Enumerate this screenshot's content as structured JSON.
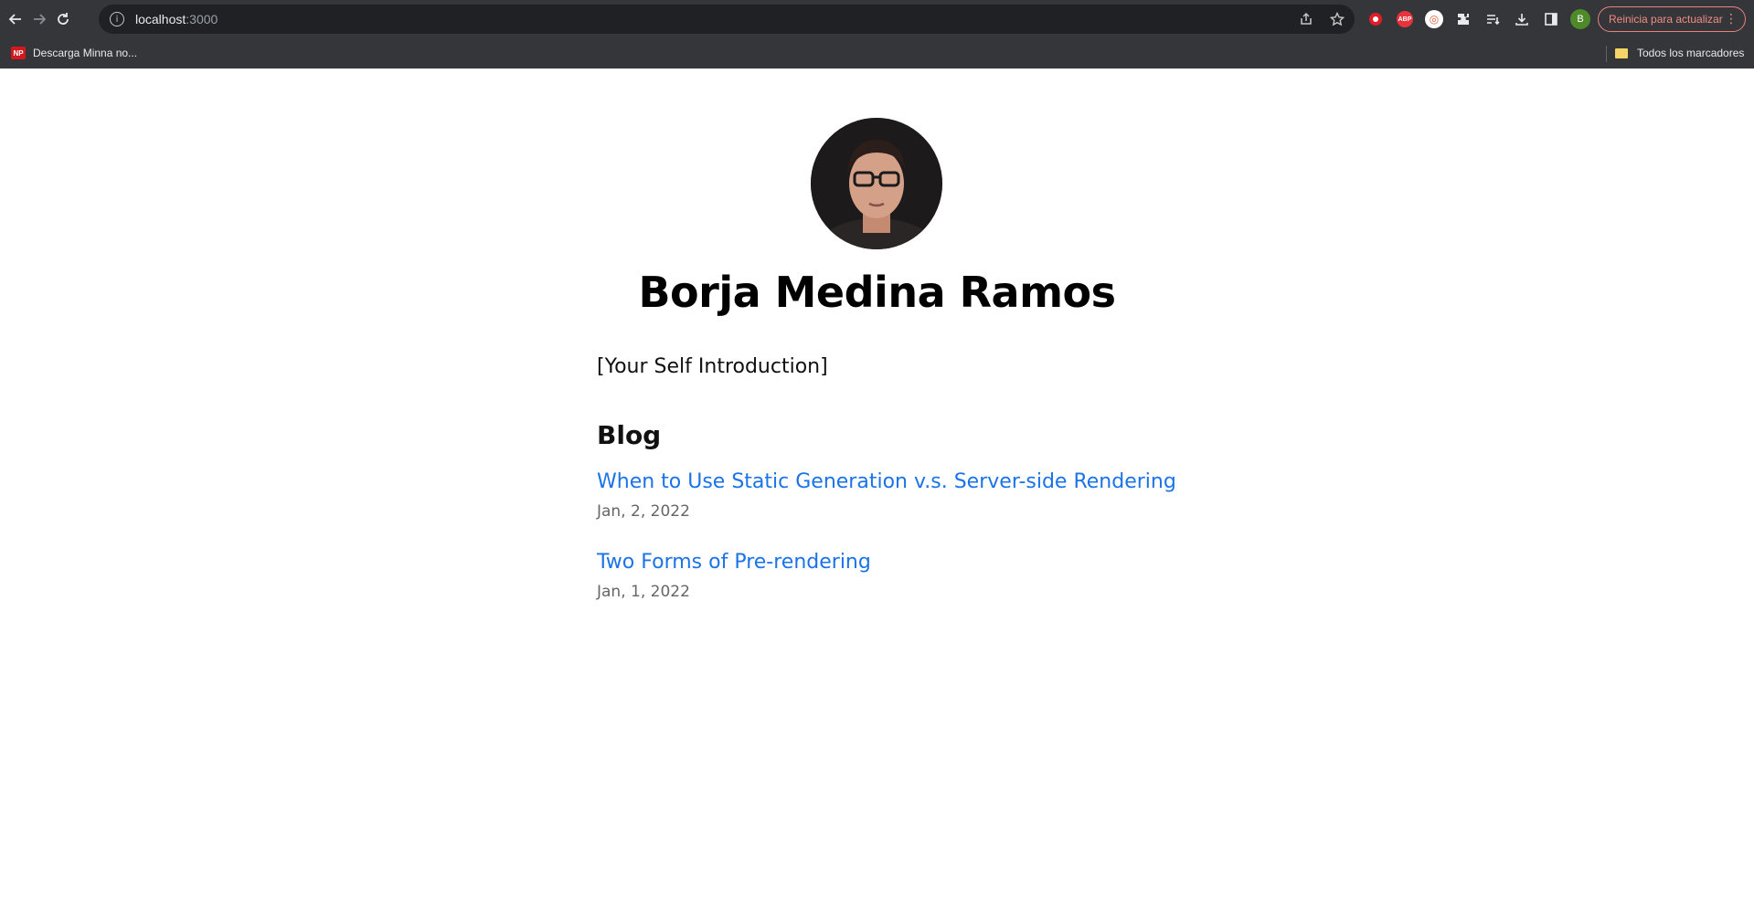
{
  "browser": {
    "url_host": "localhost",
    "url_port": ":3000",
    "update_button_label": "Reinicia para actualizar",
    "profile_initial": "B",
    "icons": {
      "back": "arrow-left-icon",
      "forward": "arrow-right-icon",
      "reload": "reload-icon",
      "site_info": "info-icon",
      "share": "share-icon",
      "bookmark": "star-icon",
      "extensions": "puzzle-icon",
      "reading_list": "reading-list-icon",
      "downloads": "download-icon",
      "side_panel": "side-panel-icon",
      "menu": "more-vertical-icon"
    }
  },
  "bookmarks_bar": {
    "items": [
      {
        "badge": "NP",
        "label": "Descarga Minna no..."
      }
    ],
    "all_bookmarks_label": "Todos los marcadores"
  },
  "page": {
    "name": "Borja Medina Ramos",
    "intro": "[Your Self Introduction]",
    "blog_heading": "Blog",
    "posts": [
      {
        "title": "When to Use Static Generation v.s. Server-side Rendering",
        "date": "Jan, 2, 2022"
      },
      {
        "title": "Two Forms of Pre-rendering",
        "date": "Jan, 1, 2022"
      }
    ]
  },
  "colors": {
    "link": "#1a73e8",
    "chrome_bg": "#35363a",
    "omnibox_bg": "#202124",
    "update_accent": "#f28b82"
  }
}
